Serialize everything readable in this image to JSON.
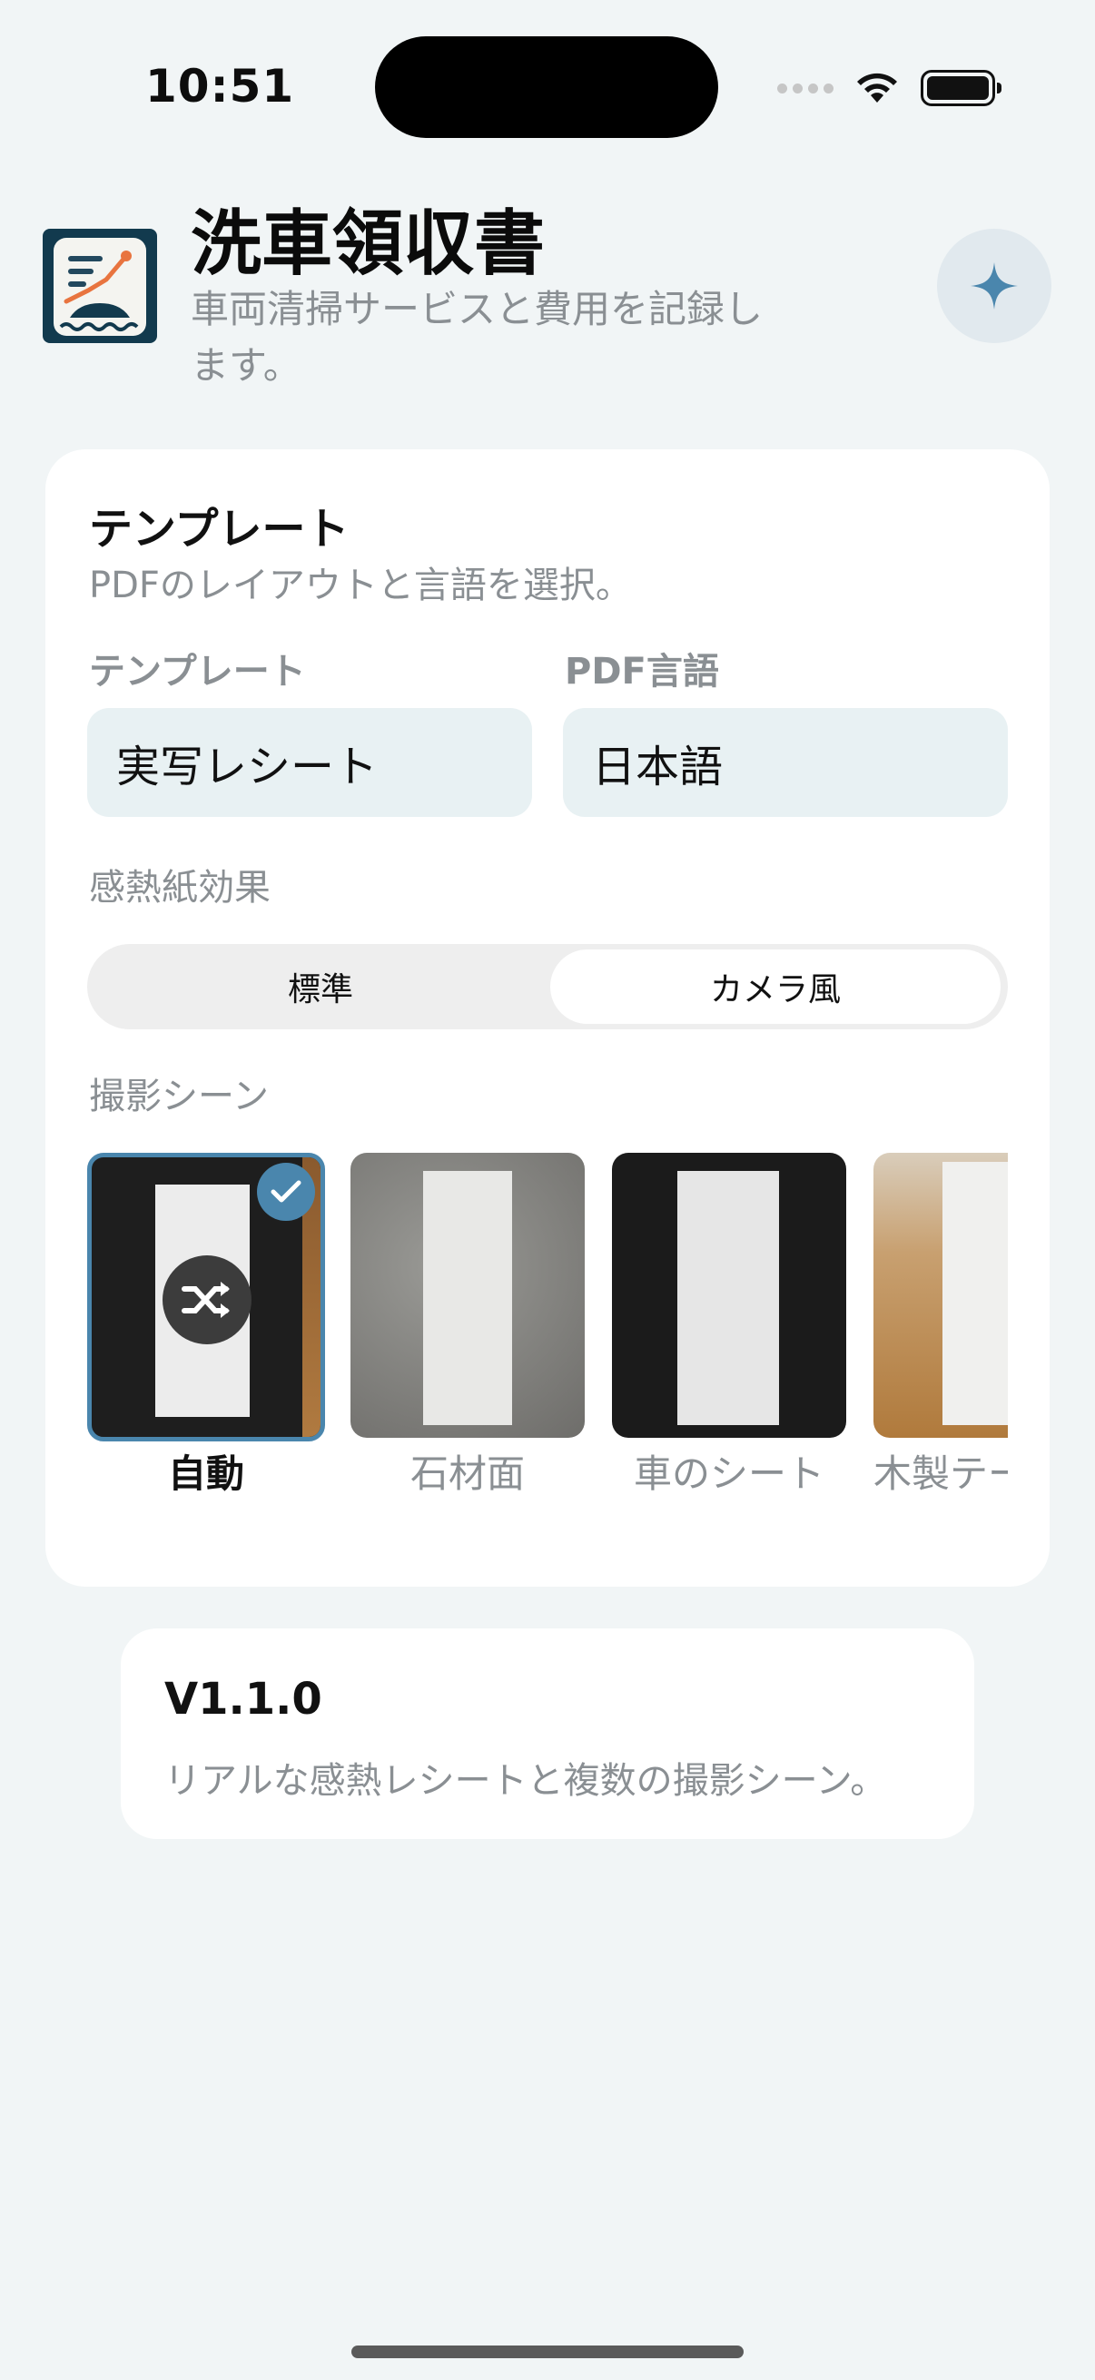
{
  "status_bar": {
    "time": "10:51"
  },
  "header": {
    "title": "洗車領収書",
    "subtitle": "車両清掃サービスと費用を記録します。",
    "app_icon": "receipt-car-app-icon",
    "action_icon": "sparkle-icon"
  },
  "template_card": {
    "title": "テンプレート",
    "subtitle": "PDFのレイアウトと言語を選択。",
    "template_label": "テンプレート",
    "template_value": "実写レシート",
    "language_label": "PDF言語",
    "language_value": "日本語",
    "thermal_label": "感熱紙効果",
    "thermal_options": [
      "標準",
      "カメラ風"
    ],
    "thermal_selected": "カメラ風",
    "scene_label": "撮影シーン",
    "scenes": [
      {
        "label": "自動",
        "selected": true,
        "icon": "shuffle-icon"
      },
      {
        "label": "石材面",
        "selected": false
      },
      {
        "label": "車のシート",
        "selected": false
      },
      {
        "label": "木製テー",
        "selected": false
      }
    ]
  },
  "version_card": {
    "title": "V1.1.0",
    "description": "リアルな感熱レシートと複数の撮影シーン。"
  },
  "colors": {
    "accent": "#4a86ad",
    "background": "#f1f5f6",
    "secondary_text": "#8a8f93",
    "field_bg": "#e8f1f3"
  }
}
